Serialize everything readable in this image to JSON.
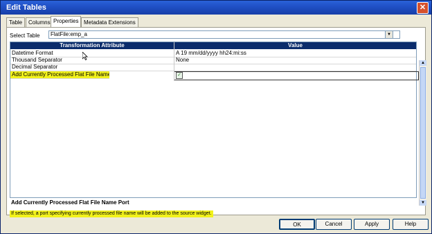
{
  "window": {
    "title": "Edit Tables",
    "close_glyph": "✕"
  },
  "tabs": [
    {
      "label": "Table"
    },
    {
      "label": "Columns"
    },
    {
      "label": "Properties"
    },
    {
      "label": "Metadata Extensions"
    }
  ],
  "select_table": {
    "label": "Select Table",
    "value": "FlatFile:emp_a",
    "arrow": "▼"
  },
  "grid": {
    "headers": {
      "attribute": "Transformation Attribute",
      "value": "Value"
    },
    "rows": [
      {
        "attribute": "Datetime Format",
        "value": "A 19 mm/dd/yyyy hh24:mi:ss"
      },
      {
        "attribute": "Thousand Separator",
        "value": "None"
      },
      {
        "attribute": "Decimal Separator",
        "value": ""
      },
      {
        "attribute": "Add Currently Processed Flat File Name Port",
        "value": "",
        "checked": true
      }
    ]
  },
  "description": {
    "title": "Add Currently Processed Flat File Name Port",
    "text": "If selected, a port specifying currently processed file name will be added to the source widget."
  },
  "buttons": {
    "ok": "OK",
    "cancel": "Cancel",
    "apply": "Apply",
    "help": "Help"
  },
  "icons": {
    "checkbox": "checkmark-icon",
    "scroll_up": "▲",
    "scroll_down": "▼"
  },
  "colors": {
    "title_bar": "#1f4fc4",
    "header_bg": "#0b2c6b",
    "highlight": "#f2f21c"
  }
}
